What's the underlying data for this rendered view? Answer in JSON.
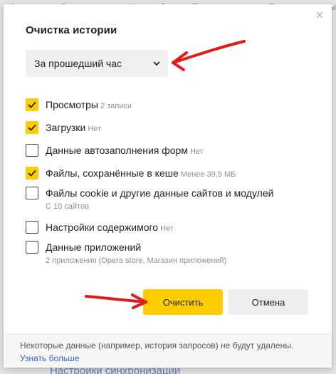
{
  "background": {
    "nav_items": [
      "История",
      "Дополнения",
      "Настройки",
      "Безопасность",
      "Пароли и карты"
    ],
    "bottom_link": "Настройки синхронизации"
  },
  "dialog": {
    "title": "Очистка истории",
    "period_select": {
      "selected": "За прошедший час"
    },
    "options": [
      {
        "label": "Просмотры",
        "detail": "2 записи",
        "checked": true
      },
      {
        "label": "Загрузки",
        "detail": "Нет",
        "checked": true
      },
      {
        "label": "Данные автозаполнения форм",
        "detail": "Нет",
        "checked": false
      },
      {
        "label": "Файлы, сохранённые в кеше",
        "detail": "Менее 39,5 МБ",
        "checked": true
      },
      {
        "label": "Файлы cookie и другие данные сайтов и модулей",
        "detail": "С 10 сайтов",
        "checked": false
      },
      {
        "label": "Настройки содержимого",
        "detail": "Нет",
        "checked": false
      },
      {
        "label": "Данные приложений",
        "detail": "2 приложения (Opera store, Магазин приложений)",
        "checked": false
      }
    ],
    "buttons": {
      "clear": "Очистить",
      "cancel": "Отмена"
    },
    "footer": {
      "note": "Некоторые данные (например, история запросов) не будут удалены.",
      "link": "Узнать больше"
    }
  },
  "colors": {
    "accent": "#ffcc00",
    "link": "#2f66c5",
    "annotation": "#e31b1b"
  },
  "icons": {
    "close": "close-icon",
    "chevron": "chevron-down-icon",
    "check": "checkmark-icon"
  }
}
